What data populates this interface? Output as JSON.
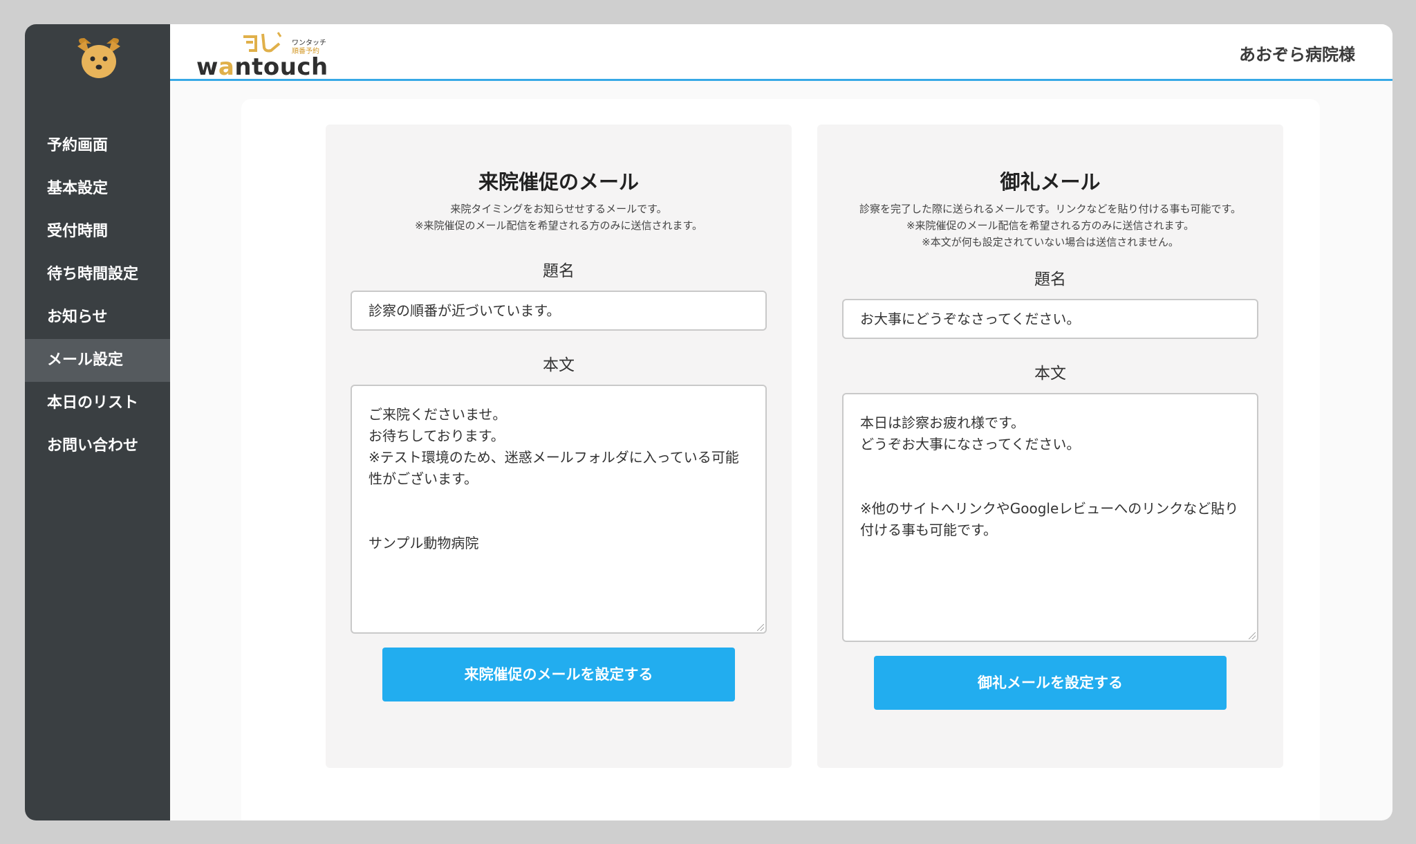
{
  "sidebar": {
    "items": [
      {
        "label": "予約画面"
      },
      {
        "label": "基本設定"
      },
      {
        "label": "受付時間"
      },
      {
        "label": "待ち時間設定"
      },
      {
        "label": "お知らせ"
      },
      {
        "label": "メール設定",
        "active": true
      },
      {
        "label": "本日のリスト"
      },
      {
        "label": "お問い合わせ"
      }
    ]
  },
  "header": {
    "logo": {
      "wordmark_pre": "w",
      "wordmark_a": "a",
      "wordmark_post": "ntouch",
      "tag1": "ワンタッチ",
      "tag2": "順番予約"
    },
    "hospital_name": "あおぞら病院様"
  },
  "left_card": {
    "title": "来院催促のメール",
    "desc": [
      "来院タイミングをお知らせせするメールです。",
      "※来院催促のメール配信を希望される方のみに送信されます。"
    ],
    "subject_label": "題名",
    "subject_value": "診察の順番が近づいています。",
    "body_label": "本文",
    "body_value": "ご来院くださいませ。\nお待ちしております。\n※テスト環境のため、迷惑メールフォルダに入っている可能性がございます。\n\n\nサンプル動物病院",
    "button": "来院催促のメールを設定する"
  },
  "right_card": {
    "title": "御礼メール",
    "desc": [
      "診察を完了した際に送られるメールです。リンクなどを貼り付ける事も可能です。",
      "※来院催促のメール配信を希望される方のみに送信されます。",
      "※本文が何も設定されていない場合は送信されません。"
    ],
    "subject_label": "題名",
    "subject_value": "お大事にどうぞなさってください。",
    "body_label": "本文",
    "body_value": "本日は診察お疲れ様です。\nどうぞお大事になさってください。\n\n\n※他のサイトへリンクやGoogleレビューへのリンクなど貼り付ける事も可能です。",
    "button": "御礼メールを設定する"
  },
  "colors": {
    "accent": "#22adef",
    "sidebar_bg": "#3a3f42",
    "header_line": "#37a9e6",
    "logo_gold": "#e0b04a"
  },
  "icons": {
    "sidebar_logo": "dog-face-icon",
    "logo_mark": "dog-ears-icon"
  }
}
